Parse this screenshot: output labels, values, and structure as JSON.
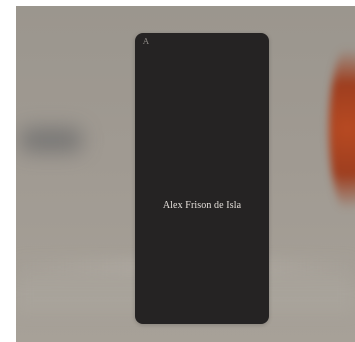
{
  "logo": {
    "text": "A"
  },
  "profile": {
    "name": "Alex Frison de Isla"
  },
  "contact": {
    "lines": [
      "",
      "",
      ""
    ]
  }
}
